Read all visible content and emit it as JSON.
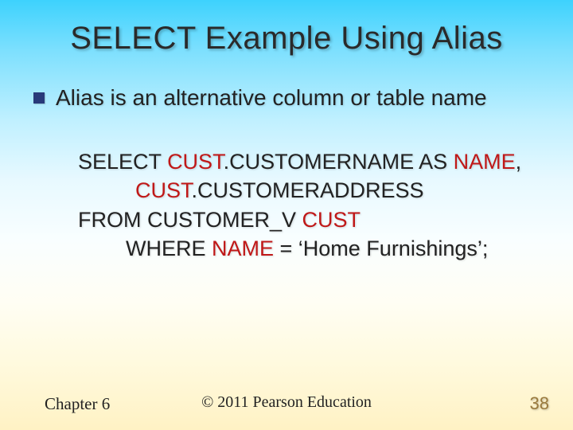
{
  "title": "SELECT Example Using Alias",
  "bullet": "Alias is an alternative column or table name",
  "code": {
    "l1a": "SELECT ",
    "l1b": "CUST",
    "l1c": ".CUSTOMERNAME AS ",
    "l1d": "NAME",
    "l1e": ",",
    "l2a": "CUST",
    "l2b": ".CUSTOMERADDRESS",
    "l3a": "FROM CUSTOMER_V ",
    "l3b": "CUST",
    "l4a": "WHERE ",
    "l4b": "NAME",
    "l4c": " = ‘Home Furnishings’;"
  },
  "footer": {
    "chapter": "Chapter 6",
    "copyright": "© 2011 Pearson Education",
    "page": "38"
  }
}
